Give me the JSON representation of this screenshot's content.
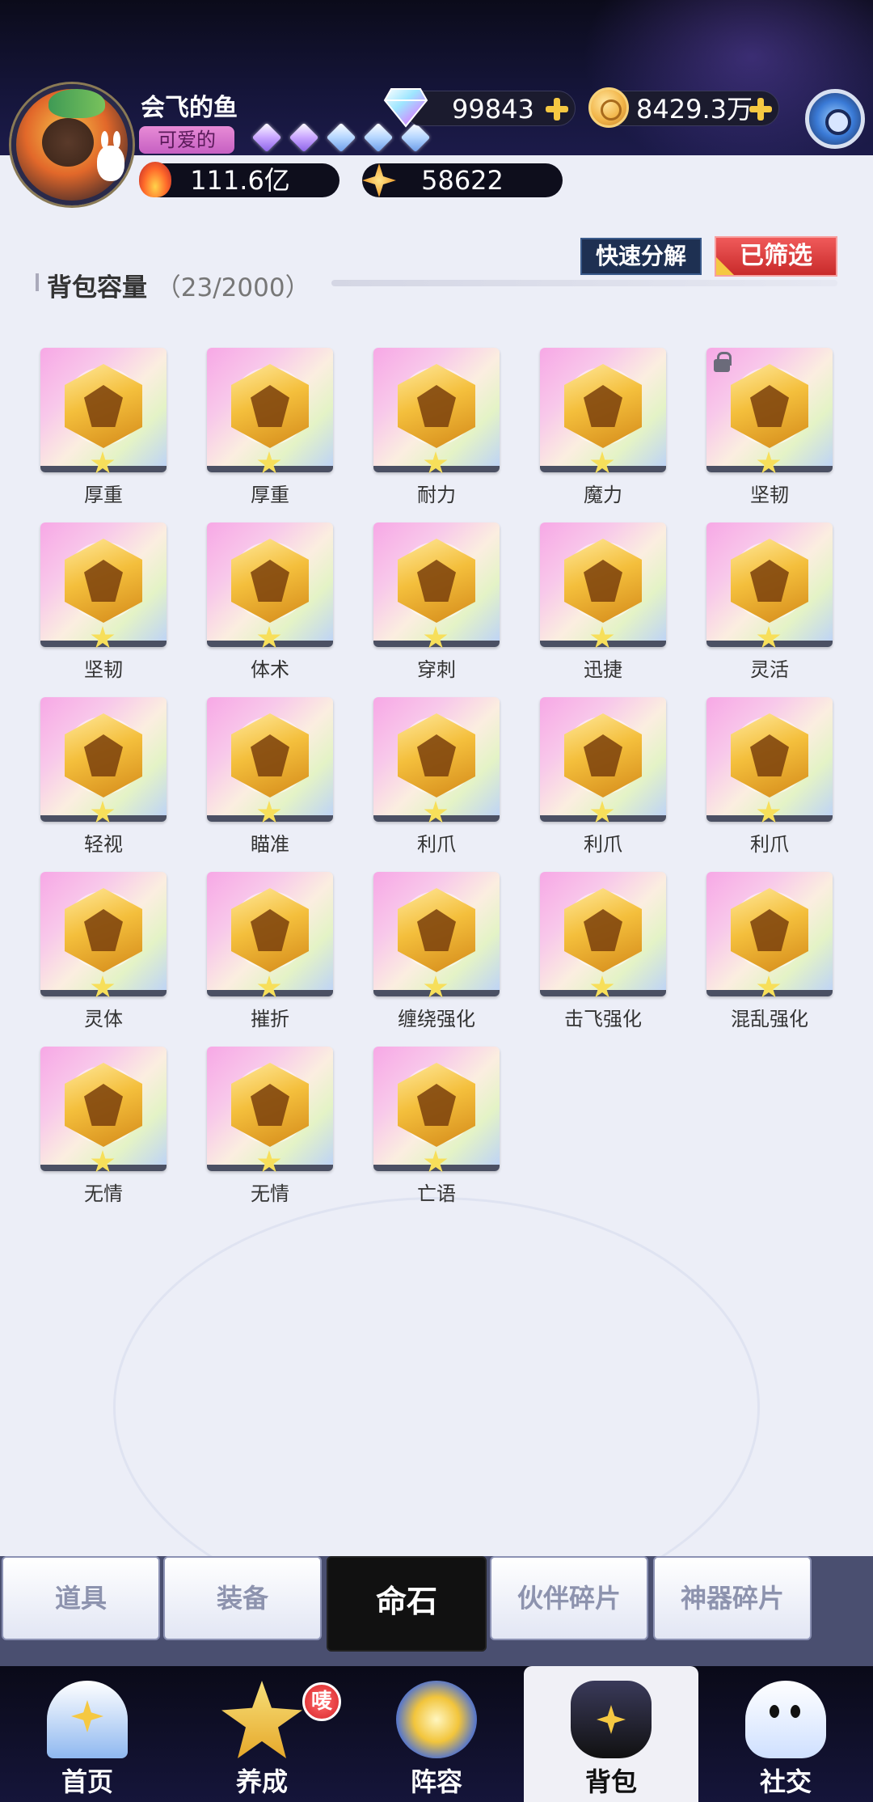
{
  "header": {
    "username": "会飞的鱼",
    "title_badge": "可爱的",
    "gems": "99843",
    "coins": "8429.3万",
    "power": "111.6亿",
    "stars": "58622"
  },
  "bag": {
    "capacity_label": "背包容量",
    "capacity_count": "（23/2000）",
    "quick_decompose": "快速分解",
    "filtered": "已筛选",
    "items": [
      {
        "name": "厚重",
        "locked": false
      },
      {
        "name": "厚重",
        "locked": false
      },
      {
        "name": "耐力",
        "locked": false
      },
      {
        "name": "魔力",
        "locked": false
      },
      {
        "name": "坚韧",
        "locked": true
      },
      {
        "name": "坚韧",
        "locked": false
      },
      {
        "name": "体术",
        "locked": false
      },
      {
        "name": "穿刺",
        "locked": false
      },
      {
        "name": "迅捷",
        "locked": false
      },
      {
        "name": "灵活",
        "locked": false
      },
      {
        "name": "轻视",
        "locked": false
      },
      {
        "name": "瞄准",
        "locked": false
      },
      {
        "name": "利爪",
        "locked": false
      },
      {
        "name": "利爪",
        "locked": false
      },
      {
        "name": "利爪",
        "locked": false
      },
      {
        "name": "灵体",
        "locked": false
      },
      {
        "name": "摧折",
        "locked": false
      },
      {
        "name": "缠绕强化",
        "locked": false
      },
      {
        "name": "击飞强化",
        "locked": false
      },
      {
        "name": "混乱强化",
        "locked": false
      },
      {
        "name": "无情",
        "locked": false
      },
      {
        "name": "无情",
        "locked": false
      },
      {
        "name": "亡语",
        "locked": false
      }
    ]
  },
  "subtabs": [
    "道具",
    "装备",
    "命石",
    "伙伴碎片",
    "神器碎片"
  ],
  "active_subtab": 2,
  "nav": {
    "items": [
      "首页",
      "养成",
      "阵容",
      "背包",
      "社交"
    ],
    "active": 3,
    "badge": "唛"
  },
  "colors": {
    "accent_red": "#d8262a",
    "gold": "#f5c842"
  }
}
